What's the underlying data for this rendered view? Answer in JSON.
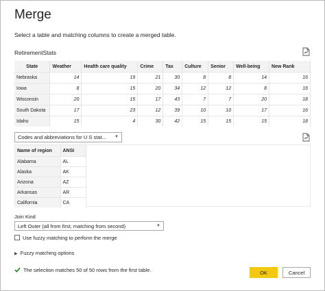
{
  "dialog": {
    "title": "Merge",
    "subtitle": "Select a table and matching columns to create a merged table."
  },
  "table1": {
    "name": "RetirementStats",
    "columns": [
      "State",
      "Weather",
      "Health care quality",
      "Crime",
      "Tax",
      "Culture",
      "Senior",
      "Well-being",
      "New Rank"
    ],
    "rows": [
      [
        "Nebraska",
        "14",
        "19",
        "21",
        "30",
        "8",
        "8",
        "14",
        "16"
      ],
      [
        "Iowa",
        "8",
        "15",
        "20",
        "34",
        "12",
        "12",
        "8",
        "16"
      ],
      [
        "Wisconsin",
        "20",
        "15",
        "17",
        "43",
        "7",
        "7",
        "20",
        "18"
      ],
      [
        "South Dakota",
        "17",
        "23",
        "12",
        "39",
        "10",
        "10",
        "17",
        "16"
      ],
      [
        "Idaho",
        "15",
        "4",
        "30",
        "42",
        "15",
        "15",
        "15",
        "18"
      ]
    ]
  },
  "table2": {
    "select_value": "Codes and abbreviations for U S stat...",
    "columns": [
      "Name of region",
      "ANSI"
    ],
    "rows": [
      [
        "Alabama",
        "AL"
      ],
      [
        "Alaska",
        "AK"
      ],
      [
        "Arizona",
        "AZ"
      ],
      [
        "Arkansas",
        "AR"
      ],
      [
        "California",
        "CA"
      ]
    ]
  },
  "join": {
    "label": "Join Kind",
    "value": "Left Outer (all from first, matching from second)",
    "fuzzy_checkbox_label": "Use fuzzy matching to perform the merge",
    "fuzzy_checked": false,
    "fuzzy_options_label": "Fuzzy matching options"
  },
  "status": {
    "message": "The selection matches 50 of 50 rows from the first table.",
    "color": "#107c10"
  },
  "buttons": {
    "ok": "OK",
    "cancel": "Cancel",
    "ok_color": "#f2c811"
  },
  "icons": {
    "preview_1": "table-preview-icon",
    "preview_2": "table-preview-icon",
    "dropdown_caret": "chevron-down-icon",
    "expand": "triangle-right-icon",
    "check": "checkmark-icon"
  }
}
